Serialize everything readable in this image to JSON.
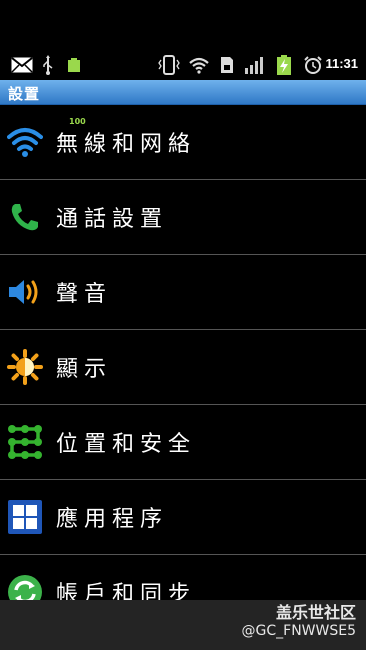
{
  "status_bar": {
    "time": "11:31",
    "battery_text": "100",
    "icons": [
      "mail-icon",
      "usb-icon",
      "battery-icon",
      "vibrate-icon",
      "wifi-icon",
      "sd-card-icon",
      "signal-icon",
      "battery-charging-icon",
      "alarm-icon"
    ]
  },
  "titlebar": {
    "title": "設置"
  },
  "settings": {
    "items": [
      {
        "label": "無線和网絡",
        "icon": "wifi-icon",
        "color": "#2a8ee6"
      },
      {
        "label": "通話設置",
        "icon": "phone-icon",
        "color": "#2fb34a"
      },
      {
        "label": "聲音",
        "icon": "speaker-icon",
        "color": "#2d88e0"
      },
      {
        "label": "顯示",
        "icon": "brightness-icon",
        "color": "#f3a11a"
      },
      {
        "label": "位置和安全",
        "icon": "lock-pattern-icon",
        "color": "#35b32f"
      },
      {
        "label": "應用程序",
        "icon": "apps-grid-icon",
        "color": "#1f56b8"
      },
      {
        "label": "帳戶和同步",
        "icon": "sync-icon",
        "color": "#3cb24a"
      }
    ]
  },
  "watermark": {
    "line1": "盖乐世社区",
    "line2": "@GC_FNWWSE5"
  }
}
